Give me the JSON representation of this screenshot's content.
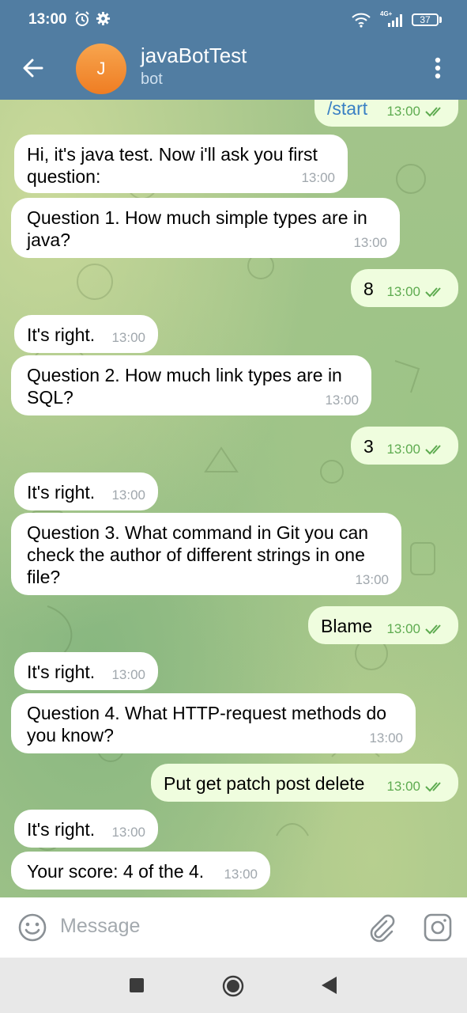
{
  "status": {
    "time": "13:00",
    "network": "4G+",
    "battery": "37"
  },
  "header": {
    "avatar_letter": "J",
    "title": "javaBotTest",
    "subtitle": "bot"
  },
  "messages": [
    {
      "text": "/start",
      "time": "13:00",
      "out": true
    },
    {
      "text": "Hi, it's java test. Now i'll ask you first question:",
      "time": "13:00"
    },
    {
      "text": "Question 1. How much simple types are in java?",
      "time": "13:00"
    },
    {
      "text": "8",
      "time": "13:00",
      "out": true
    },
    {
      "text": "It's right.",
      "time": "13:00"
    },
    {
      "text": "Question 2. How much link types are in SQL?",
      "time": "13:00"
    },
    {
      "text": "3",
      "time": "13:00",
      "out": true
    },
    {
      "text": "It's right.",
      "time": "13:00"
    },
    {
      "text": "Question 3. What command in Git you can check the author of different strings in one file?",
      "time": "13:00"
    },
    {
      "text": "Blame",
      "time": "13:00",
      "out": true
    },
    {
      "text": "It's right.",
      "time": "13:00"
    },
    {
      "text": "Question 4. What HTTP-request methods do you know?",
      "time": "13:00"
    },
    {
      "text": "Put get patch post delete",
      "time": "13:00",
      "out": true
    },
    {
      "text": "It's right.",
      "time": "13:00"
    },
    {
      "text": "Your score: 4 of the 4.",
      "time": "13:00"
    }
  ],
  "composer": {
    "placeholder": "Message"
  },
  "icons": {
    "back": "arrow-left-icon",
    "menu": "more-vert-icon",
    "emoji": "emoji-icon",
    "attach": "paperclip-icon",
    "camera": "camera-icon",
    "read": "double-check-icon"
  },
  "colors": {
    "header": "#517da2",
    "incoming_bubble": "#ffffff",
    "outgoing_bubble": "#effdde",
    "outgoing_time": "#5eab50",
    "command_link": "#3a80c4",
    "avatar": "#ef7d23"
  }
}
